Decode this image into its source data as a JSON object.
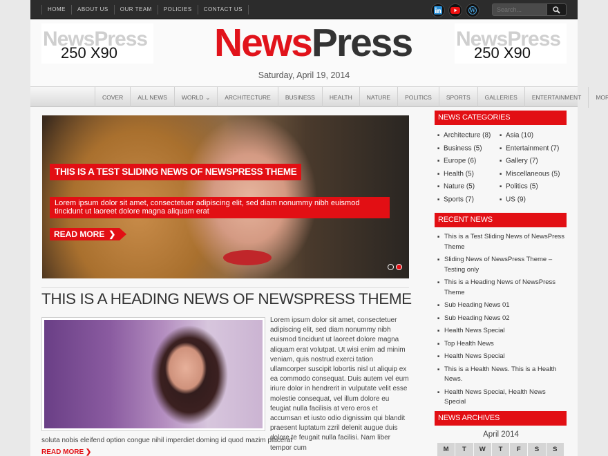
{
  "topnav": {
    "items": [
      "HOME",
      "ABOUT US",
      "OUR TEAM",
      "POLICIES",
      "CONTACT US"
    ]
  },
  "social": {
    "icons": [
      "linkedin-icon",
      "youtube-icon",
      "wordpress-icon"
    ]
  },
  "search": {
    "placeholder": "Search..."
  },
  "header": {
    "ad_left": {
      "ghost": "NewsPress",
      "size": "250 X90"
    },
    "ad_right": {
      "ghost": "NewsPress",
      "size": "250 X90"
    },
    "logo_part1": "News",
    "logo_part2": "Press",
    "date": "Saturday, April 19, 2014"
  },
  "mainnav": {
    "items": [
      "COVER",
      "ALL NEWS",
      "WORLD",
      "ARCHITECTURE",
      "BUSINESS",
      "HEALTH",
      "NATURE",
      "POLITICS",
      "SPORTS",
      "GALLERIES",
      "ENTERTAINMENT",
      "MORE . . ."
    ]
  },
  "slider": {
    "title": "THIS IS A TEST SLIDING NEWS OF NEWSPRESS THEME",
    "text": "Lorem ipsum dolor sit amet, consectetuer adipiscing elit, sed diam nonummy nibh euismod tincidunt ut laoreet dolore magna aliquam erat",
    "readmore": "READ MORE",
    "readmore_arrow": "❯"
  },
  "post": {
    "title": "THIS IS A HEADING NEWS OF NEWSPRESS THEME",
    "text": "Lorem ipsum dolor sit amet, consectetuer adipiscing elit, sed diam nonummy nibh euismod tincidunt ut laoreet dolore magna aliquam erat volutpat. Ut wisi enim ad minim veniam, quis nostrud exerci tation ullamcorper suscipit lobortis nisl ut aliquip ex ea commodo consequat. Duis autem vel eum iriure dolor in hendrerit in vulputate velit esse molestie consequat, vel illum dolore eu feugiat nulla facilisis at vero eros et accumsan et iusto odio dignissim qui blandit praesent luptatum zzril delenit augue duis dolore te feugait nulla facilisi. Nam liber tempor cum",
    "text_cont": "soluta nobis eleifend option congue nihil imperdiet doming id quod mazim placerat",
    "readmore": "READ MORE ❯"
  },
  "sidebar": {
    "categories_title": "NEWS CATEGORIES",
    "categories": [
      "Architecture (8)",
      "Asia (10)",
      "Business (5)",
      "Entertainment (7)",
      "Europe (6)",
      "Gallery (7)",
      "Health (5)",
      "Miscellaneous (5)",
      "Nature (5)",
      "Politics (5)",
      "Sports (7)",
      "US (9)"
    ],
    "recent_title": "RECENT NEWS",
    "recent": [
      "This is a Test Sliding News of NewsPress Theme",
      "Sliding News of NewsPress Theme – Testing only",
      "This is a Heading News of NewsPress Theme",
      "Sub Heading News 01",
      "Sub Heading News 02",
      "Health News Special",
      "Top Health News",
      "Health News Special",
      "This is a Health News. This is a Health News.",
      "Health News Special, Health News Special"
    ],
    "archives_title": "NEWS ARCHIVES",
    "calendar_month": "April 2014",
    "calendar_days": [
      "M",
      "T",
      "W",
      "T",
      "F",
      "S",
      "S"
    ]
  },
  "colors": {
    "accent": "#e20f14",
    "topbar": "#2c2c2c"
  }
}
